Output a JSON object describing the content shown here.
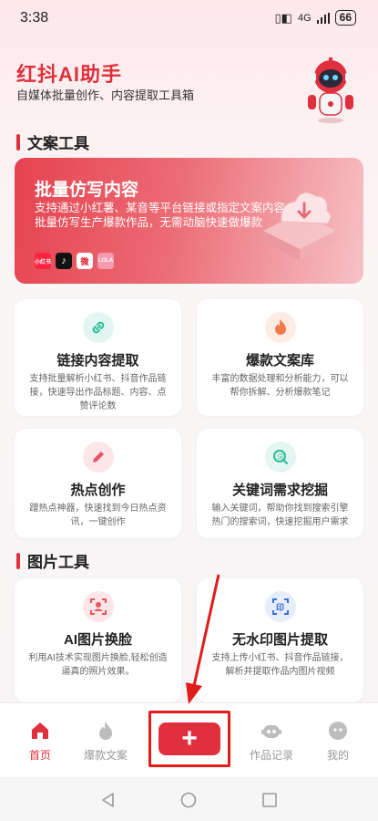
{
  "status_bar": {
    "time": "3:38",
    "network": "4G",
    "battery": "66"
  },
  "header": {
    "title": "红抖AI助手",
    "subtitle": "自媒体批量创作、内容提取工具箱"
  },
  "sections": {
    "copy_tools": "文案工具",
    "image_tools": "图片工具"
  },
  "banner": {
    "title": "批量仿写内容",
    "description": "支持通过小红薯、某音等平台链接或指定文案内容，批量仿写生产爆款作品，无需动脑快速做爆款",
    "logos": [
      "小红书",
      "♪",
      "微",
      "LOLA"
    ]
  },
  "cards": [
    {
      "title": "链接内容提取",
      "desc": "支持批量解析小红书、抖音作品链接，快速导出作品标题、内容、点赞评论数",
      "icon": "link-icon"
    },
    {
      "title": "爆款文案库",
      "desc": "丰富的数据处理和分析能力，可以帮你拆解、分析爆款笔记",
      "icon": "fire-icon"
    },
    {
      "title": "热点创作",
      "desc": "蹭热点神器，快速找到今日热点资讯，一键创作",
      "icon": "pencil-icon"
    },
    {
      "title": "关键词需求挖掘",
      "desc": "输入关键词，帮助你找到搜索引擎热门的搜索词，快速挖掘用户需求",
      "icon": "keyword-icon"
    },
    {
      "title": "AI图片换脸",
      "desc": "利用AI技术实现图片换脸,轻松创造逼真的照片效果。",
      "icon": "face-scan-icon"
    },
    {
      "title": "无水印图片提取",
      "desc": "支持上传小红书、抖音作品链接，解析并提取作品内图片视频",
      "icon": "watermark-icon"
    }
  ],
  "nav": {
    "home": "首页",
    "hot_copy": "爆款文案",
    "plus": "+",
    "works": "作品记录",
    "mine": "我的"
  },
  "colors": {
    "accent": "#e0303e",
    "annotation": "#e21b1b"
  }
}
